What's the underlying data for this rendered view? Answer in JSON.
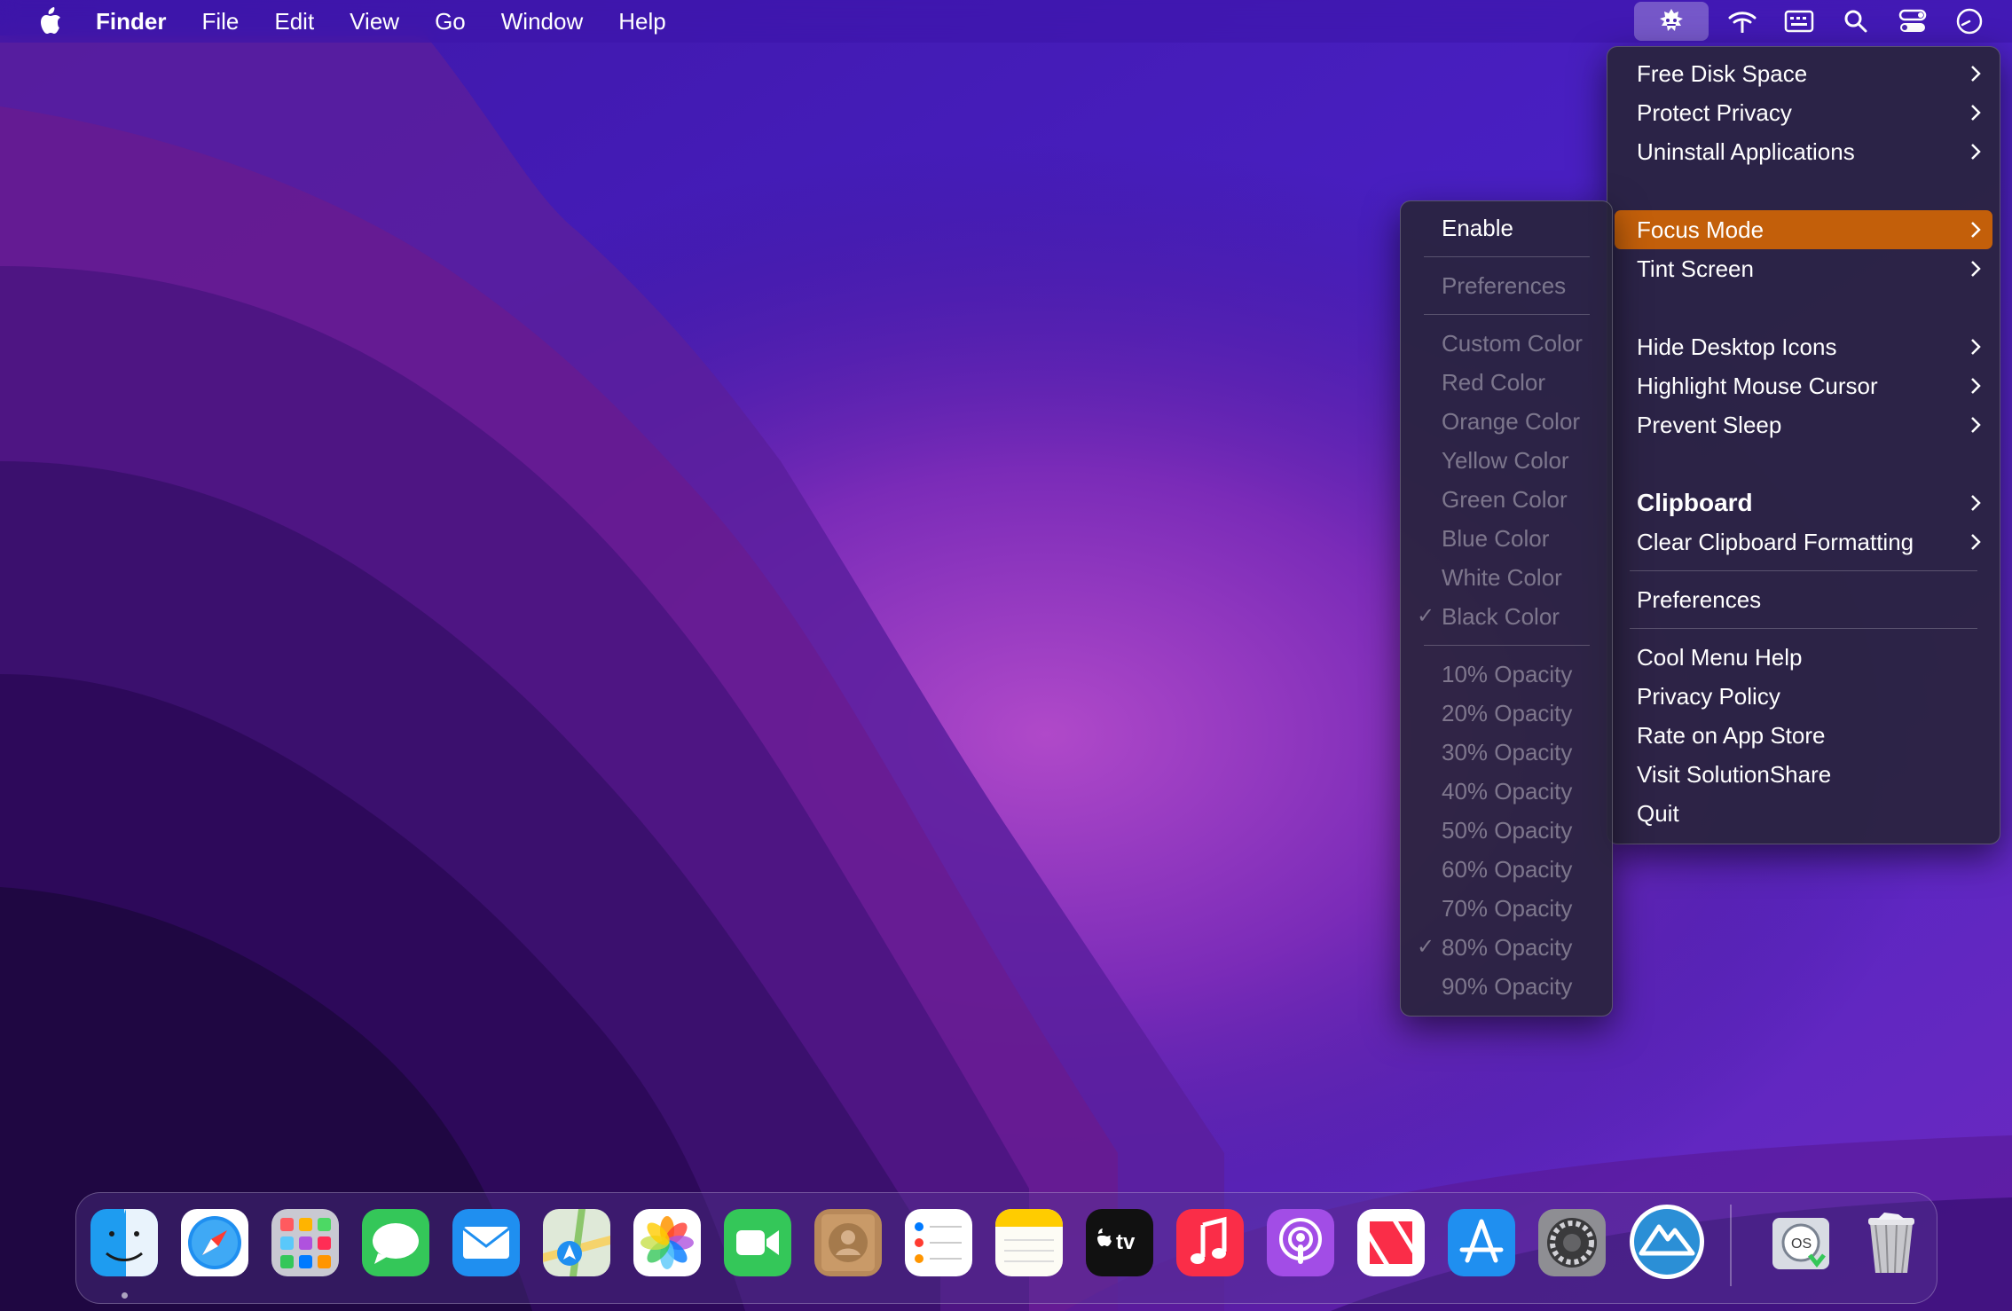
{
  "menubar": {
    "app_name": "Finder",
    "menus": [
      "File",
      "Edit",
      "View",
      "Go",
      "Window",
      "Help"
    ],
    "status_icons": [
      "cool-menu-icon",
      "wifi-icon",
      "keyboard-viewer-icon",
      "spotlight-search-icon",
      "control-center-icon",
      "clock-icon"
    ]
  },
  "main_menu": {
    "items": [
      {
        "label": "Free Disk Space"
      },
      {
        "label": "Protect Privacy"
      },
      {
        "label": "Uninstall Applications"
      },
      {
        "label": "Focus Mode"
      },
      {
        "label": "Tint Screen"
      },
      {
        "label": "Hide Desktop Icons"
      },
      {
        "label": "Highlight Mouse Cursor"
      },
      {
        "label": "Prevent Sleep"
      },
      {
        "label": "Clipboard"
      },
      {
        "label": "Clear Clipboard Formatting"
      },
      {
        "label": "Preferences"
      },
      {
        "label": "Cool Menu Help"
      },
      {
        "label": "Privacy Policy"
      },
      {
        "label": "Rate on App Store"
      },
      {
        "label": "Visit SolutionShare"
      },
      {
        "label": "Quit"
      }
    ],
    "selected_item": "Focus Mode",
    "selection_color": "#c35f0a"
  },
  "focus_submenu": {
    "enable": "Enable",
    "preferences": "Preferences",
    "colors": [
      "Custom Color",
      "Red Color",
      "Orange Color",
      "Yellow Color",
      "Green Color",
      "Blue Color",
      "White Color",
      "Black Color"
    ],
    "selected_color": "Black Color",
    "opacities": [
      "10% Opacity",
      "20% Opacity",
      "30% Opacity",
      "40% Opacity",
      "50% Opacity",
      "60% Opacity",
      "70% Opacity",
      "80% Opacity",
      "90% Opacity"
    ],
    "selected_opacity": "80% Opacity",
    "check_glyph": "✓"
  },
  "dock": {
    "apps": [
      "Finder",
      "Safari",
      "Launchpad",
      "Messages",
      "Mail",
      "Maps",
      "Photos",
      "FaceTime",
      "Contacts",
      "Reminders",
      "Notes",
      "TV",
      "Music",
      "Podcasts",
      "News",
      "App Store",
      "System Preferences",
      "Cool Menu",
      "macOS Installer",
      "Trash"
    ],
    "tv_label": "tv"
  }
}
